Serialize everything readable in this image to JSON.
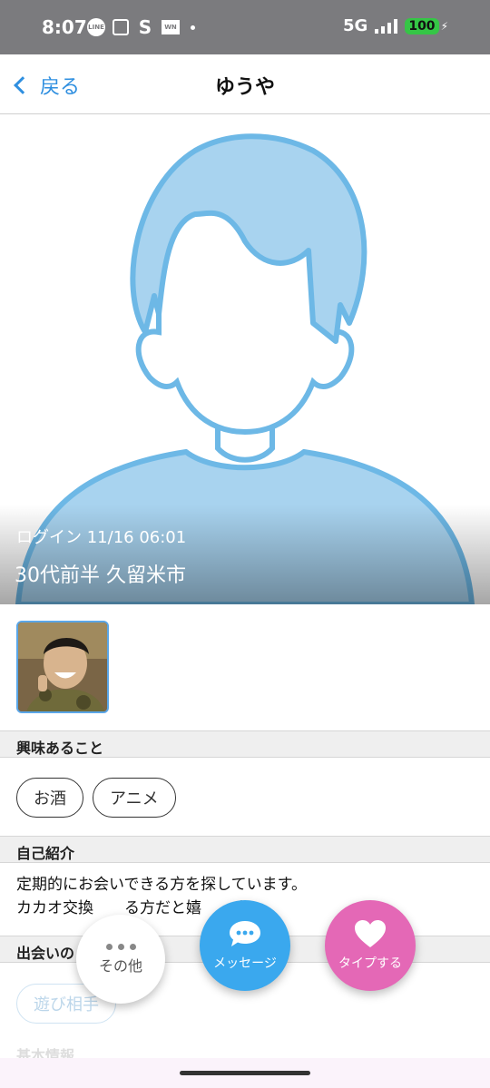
{
  "status_bar": {
    "time": "8:07",
    "network": "5G",
    "battery": "100",
    "line_icon_text": "LINE",
    "s_icon_text": "S",
    "wn_icon_text": "WN"
  },
  "nav": {
    "back_label": "戻る",
    "title": "ゆうや"
  },
  "profile": {
    "login": "ログイン 11/16 06:01",
    "age_city": "30代前半 久留米市"
  },
  "sections": {
    "interests_title": "興味あること",
    "interests": [
      "お酒",
      "アニメ"
    ],
    "intro_title": "自己紹介",
    "intro_line1": "定期的にお会いできる方を探しています。",
    "intro_line2": "カカオ交換　　る方だと嬉　　す♪",
    "purpose_title": "出会いの",
    "purpose_tags": [
      "遊び相手"
    ],
    "basic_title": "基本情報"
  },
  "actions": {
    "other_label": "その他",
    "message_label": "メッセージ",
    "like_label": "タイプする"
  },
  "colors": {
    "accent_blue": "#2f8fe0",
    "message_button": "#3aa8ee",
    "like_button": "#e468b6",
    "avatar_fill": "#a8d3ef",
    "avatar_stroke": "#6db8e6"
  }
}
